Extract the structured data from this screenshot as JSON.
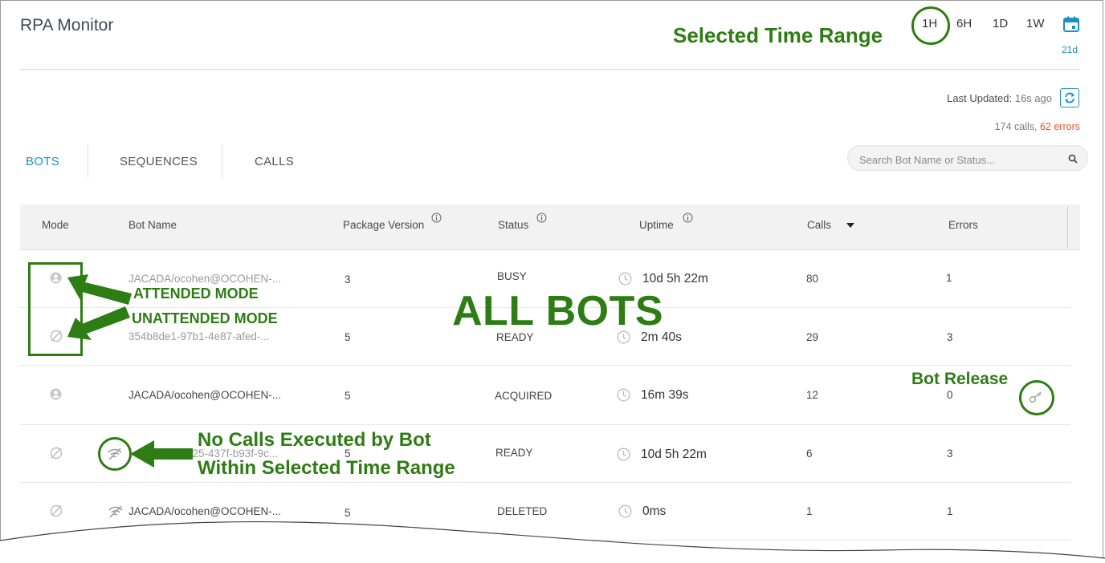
{
  "app": {
    "title": "RPA Monitor"
  },
  "time_ranges": [
    {
      "label": "1H",
      "selected": true
    },
    {
      "label": "6H",
      "selected": false
    },
    {
      "label": "1D",
      "selected": false
    },
    {
      "label": "1W",
      "selected": false
    }
  ],
  "calendar": {
    "icon": "calendar-icon",
    "label": "21d"
  },
  "status": {
    "last_updated_label": "Last Updated:",
    "last_updated_value": "16s ago",
    "calls_text": "174 calls,",
    "errors_text": "62 errors"
  },
  "tabs": [
    {
      "label": "BOTS",
      "active": true
    },
    {
      "label": "SEQUENCES",
      "active": false
    },
    {
      "label": "CALLS",
      "active": false
    }
  ],
  "search": {
    "placeholder": "Search Bot Name or Status..."
  },
  "table": {
    "columns": [
      "Mode",
      "Bot Name",
      "Package Version",
      "Status",
      "Uptime",
      "Calls",
      "Errors"
    ],
    "rows": [
      {
        "mode": "attended",
        "bot_name": "JACADA/ocohen@OCOHEN-...",
        "package_version": "3",
        "status": "BUSY",
        "uptime": "10d 5h 22m",
        "calls": "80",
        "errors": "1"
      },
      {
        "mode": "unattended",
        "bot_name": "354b8de1-97b1-4e87-afed-...",
        "package_version": "5",
        "status": "READY",
        "uptime": "2m 40s",
        "calls": "29",
        "errors": "3"
      },
      {
        "mode": "attended",
        "bot_name": "JACADA/ocohen@OCOHEN-...",
        "package_version": "5",
        "status": "ACQUIRED",
        "uptime": "16m 39s",
        "calls": "12",
        "errors": "0"
      },
      {
        "mode": "unattended",
        "bot_name": "325-437f-b93f-9c...",
        "package_version": "5",
        "status": "READY",
        "uptime": "10d 5h 22m",
        "calls": "6",
        "errors": "3"
      },
      {
        "mode": "unattended",
        "bot_name": "JACADA/ocohen@OCOHEN-...",
        "package_version": "5",
        "status": "DELETED",
        "uptime": "0ms",
        "calls": "1",
        "errors": "1"
      }
    ]
  },
  "annotations": {
    "selected_time_range": "Selected Time Range",
    "attended_mode": "ATTENDED MODE",
    "unattended_mode": "UNATTENDED MODE",
    "all_bots": "ALL BOTS",
    "bot_release": "Bot Release",
    "no_calls_line1": "No Calls Executed by Bot",
    "no_calls_line2": "Within Selected Time Range"
  },
  "colors": {
    "accent": "#1a8fc9",
    "error": "#e8542d",
    "annotation_green": "#2e7d14"
  }
}
